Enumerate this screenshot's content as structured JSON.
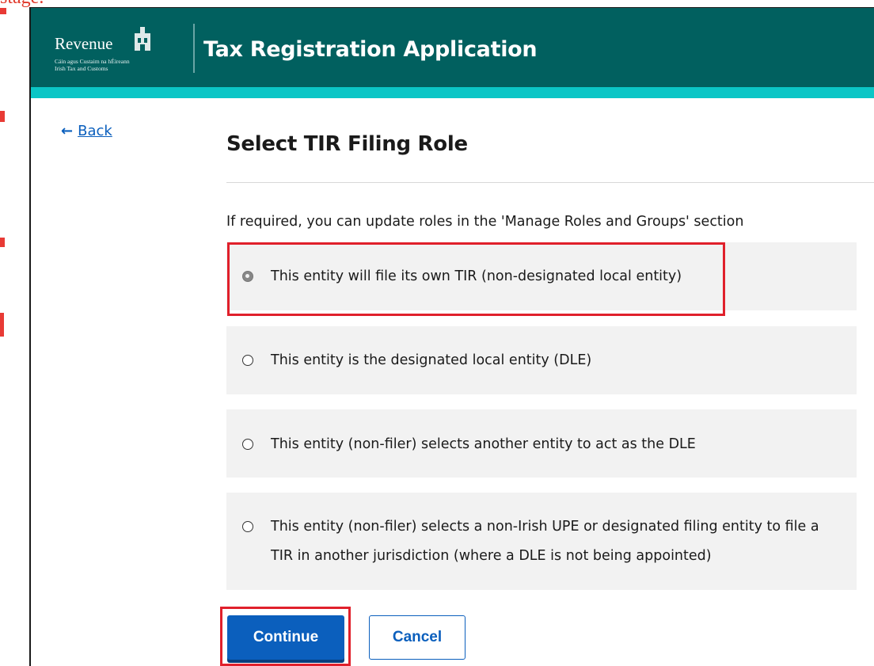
{
  "overflow_text": "stage.",
  "header": {
    "logo_word": "Revenue",
    "logo_sub_line1": "Cáin agus Custaim na hÉireann",
    "logo_sub_line2": "Irish Tax and Customs",
    "app_title": "Tax Registration Application"
  },
  "nav": {
    "back_arrow": "←",
    "back_label": "Back"
  },
  "main": {
    "title": "Select TIR Filing Role",
    "hint": "If required, you can update roles in the 'Manage Roles and Groups' section",
    "options": [
      {
        "label": "This entity will file its own TIR (non-designated local entity)",
        "selected": true
      },
      {
        "label": "This entity is the designated local entity (DLE)",
        "selected": false
      },
      {
        "label": "This entity (non-filer) selects another entity to act as the DLE",
        "selected": false
      },
      {
        "label": "This entity (non-filer) selects a non-Irish UPE or designated filing entity to file a TIR in another jurisdiction (where a DLE is not being appointed)",
        "selected": false
      }
    ]
  },
  "actions": {
    "continue_label": "Continue",
    "cancel_label": "Cancel"
  },
  "colors": {
    "header_bg": "#01605f",
    "header_stripe": "#0bc6c6",
    "primary": "#0b5fbd",
    "highlight": "#e0202b",
    "option_bg": "#f2f2f2"
  }
}
